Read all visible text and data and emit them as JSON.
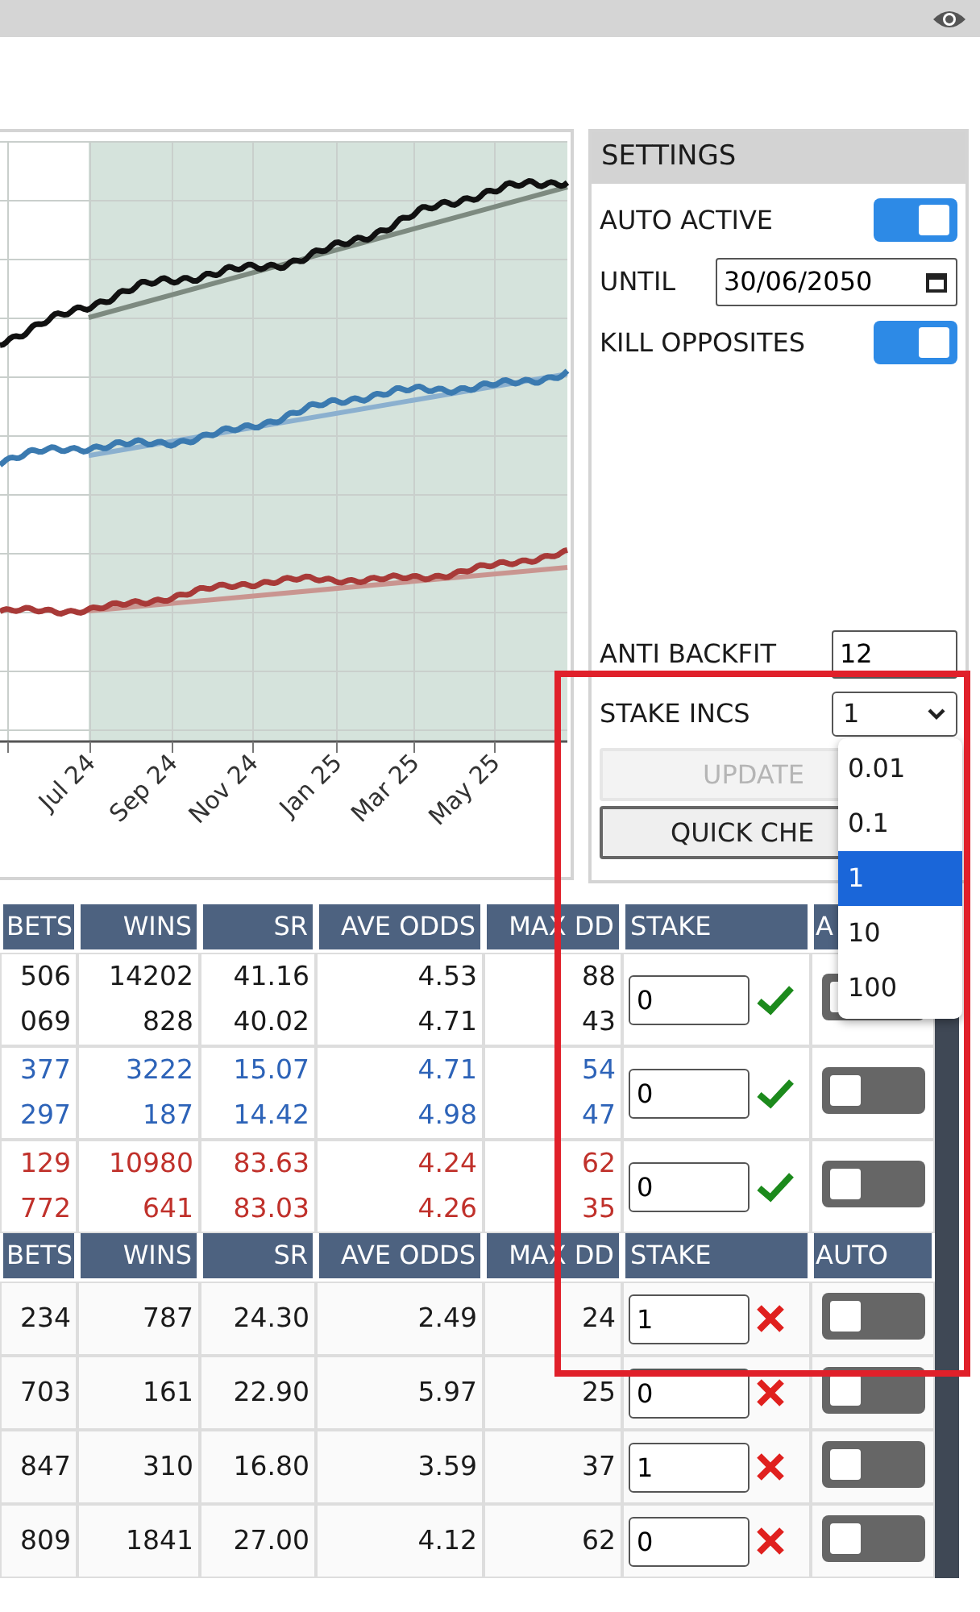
{
  "chart": {
    "x_labels": [
      "Jul 24",
      "Sep 24",
      "Nov 24",
      "Jan 25",
      "Mar 25",
      "May 25"
    ]
  },
  "settings": {
    "title": "SETTINGS",
    "top_rows": [
      {
        "kind": "toggle",
        "label": "AUTO ACTIVE",
        "on": true
      },
      {
        "kind": "date",
        "label": "UNTIL",
        "value": "30/06/2050"
      },
      {
        "kind": "toggle",
        "label": "KILL OPPOSITES",
        "on": true
      }
    ],
    "bottom_rows": [
      {
        "kind": "number",
        "label": "ANTI BACKFIT",
        "value": "12"
      },
      {
        "kind": "select",
        "label": "STAKE INCS",
        "value": "1",
        "expanded": true,
        "options": [
          {
            "label": "0.01",
            "selected": false
          },
          {
            "label": "0.1",
            "selected": false
          },
          {
            "label": "1",
            "selected": true
          },
          {
            "label": "10",
            "selected": false
          },
          {
            "label": "100",
            "selected": false
          }
        ]
      }
    ],
    "buttons": [
      {
        "label": "UPDATE",
        "disabled": true
      },
      {
        "label": "QUICK CHE",
        "disabled": false
      }
    ]
  },
  "tables": [
    {
      "columns": [
        "BETS",
        "WINS",
        "SR",
        "AVE ODDS",
        "MAX DD",
        "STAKE",
        "A"
      ],
      "groups": [
        {
          "color": "#1a1a1a",
          "lines": [
            [
              "506",
              "14202",
              "41.16",
              "4.53",
              "88"
            ],
            [
              "069",
              "828",
              "40.02",
              "4.71",
              "43"
            ]
          ],
          "stake": "0",
          "valid": true,
          "auto": false
        },
        {
          "color": "#2d63b8",
          "lines": [
            [
              "377",
              "3222",
              "15.07",
              "4.71",
              "54"
            ],
            [
              "297",
              "187",
              "14.42",
              "4.98",
              "47"
            ]
          ],
          "stake": "0",
          "valid": true,
          "auto": false
        },
        {
          "color": "#c0312b",
          "lines": [
            [
              "129",
              "10980",
              "83.63",
              "4.24",
              "62"
            ],
            [
              "772",
              "641",
              "83.03",
              "4.26",
              "35"
            ]
          ],
          "stake": "0",
          "valid": true,
          "auto": false
        }
      ]
    },
    {
      "columns": [
        "BETS",
        "WINS",
        "SR",
        "AVE ODDS",
        "MAX DD",
        "STAKE",
        "AUTO"
      ],
      "groups": [
        {
          "color": "#1a1a1a",
          "lines": [
            [
              "234",
              "787",
              "24.30",
              "2.49",
              "24"
            ]
          ],
          "stake": "1",
          "valid": false,
          "auto": false
        },
        {
          "color": "#1a1a1a",
          "lines": [
            [
              "703",
              "161",
              "22.90",
              "5.97",
              "25"
            ]
          ],
          "stake": "0",
          "valid": false,
          "auto": false
        },
        {
          "color": "#1a1a1a",
          "lines": [
            [
              "847",
              "310",
              "16.80",
              "3.59",
              "37"
            ]
          ],
          "stake": "1",
          "valid": false,
          "auto": false
        },
        {
          "color": "#1a1a1a",
          "lines": [
            [
              "809",
              "1841",
              "27.00",
              "4.12",
              "62"
            ]
          ],
          "stake": "0",
          "valid": false,
          "auto": false
        }
      ]
    }
  ]
}
